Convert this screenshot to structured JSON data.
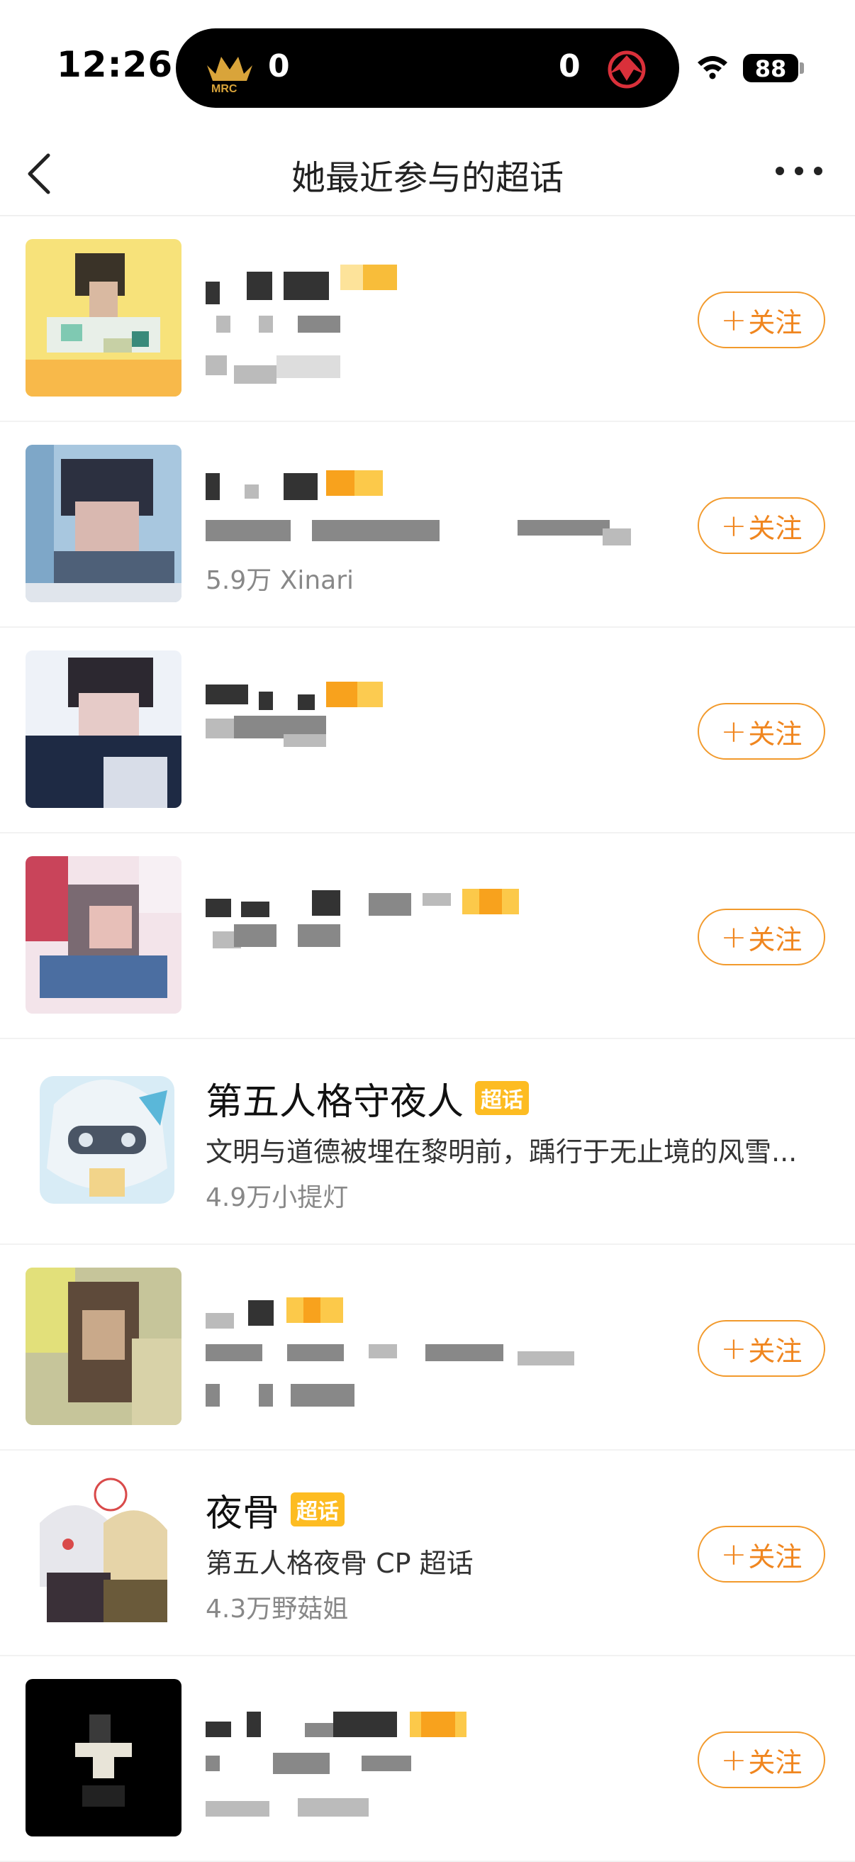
{
  "status_bar": {
    "time": "12:26",
    "score_left": "0",
    "score_right": "0",
    "battery": "88"
  },
  "nav": {
    "title": "她最近参与的超话"
  },
  "items": [
    {
      "name": "",
      "badge": "",
      "desc": "",
      "stats": "",
      "follow": "关注",
      "followed": false
    },
    {
      "name": "",
      "badge": "",
      "desc": "",
      "stats": "5.9万 Xinari",
      "follow": "关注",
      "followed": false
    },
    {
      "name": "",
      "badge": "",
      "desc": "",
      "stats": "",
      "follow": "关注",
      "followed": false
    },
    {
      "name": "",
      "badge": "",
      "desc": "",
      "stats": "",
      "follow": "关注",
      "followed": false
    },
    {
      "name": "第五人格守夜人",
      "badge": "超话",
      "desc": "文明与道德被埋在黎明前，踽行于无止境的风雪...",
      "stats": "4.9万小提灯",
      "follow": "",
      "followed": true
    },
    {
      "name": "",
      "badge": "",
      "desc": "",
      "stats": "",
      "follow": "关注",
      "followed": false
    },
    {
      "name": "夜骨",
      "badge": "超话",
      "desc": "第五人格夜骨 CP 超话",
      "stats": "4.3万野菇姐",
      "follow": "关注",
      "followed": false
    },
    {
      "name": "",
      "badge": "",
      "desc": "",
      "stats": "",
      "follow": "关注",
      "followed": false
    }
  ],
  "colors": {
    "accent": "#f0861f",
    "badge": "#fdbc22"
  }
}
